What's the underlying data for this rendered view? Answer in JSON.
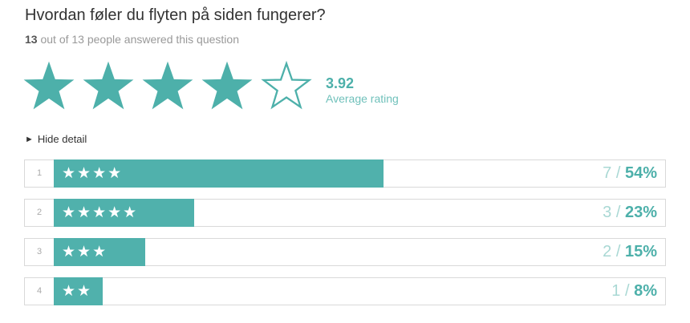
{
  "question": "Hvordan føler du flyten på siden fungerer?",
  "answered": {
    "count": "13",
    "text": "out of 13 people answered this question"
  },
  "rating": {
    "value": 3.92,
    "value_text": "3.92",
    "label": "Average rating",
    "max_stars": 5,
    "filled_stars": 4
  },
  "toggle": {
    "arrow": "►",
    "label": "Hide detail"
  },
  "breakdown": [
    {
      "index": "1",
      "stars": 4,
      "stars_text": "★★★★",
      "count": "7",
      "sep": "/",
      "percent": "54%",
      "fraction": 0.54
    },
    {
      "index": "2",
      "stars": 5,
      "stars_text": "★★★★★",
      "count": "3",
      "sep": "/",
      "percent": "23%",
      "fraction": 0.23
    },
    {
      "index": "3",
      "stars": 3,
      "stars_text": "★★★",
      "count": "2",
      "sep": "/",
      "percent": "15%",
      "fraction": 0.15
    },
    {
      "index": "4",
      "stars": 2,
      "stars_text": "★★",
      "count": "1",
      "sep": "/",
      "percent": "8%",
      "fraction": 0.08
    }
  ],
  "colors": {
    "accent": "#4db0aa",
    "bar": "#50b1ac",
    "light_accent": "#a9d8d4"
  }
}
